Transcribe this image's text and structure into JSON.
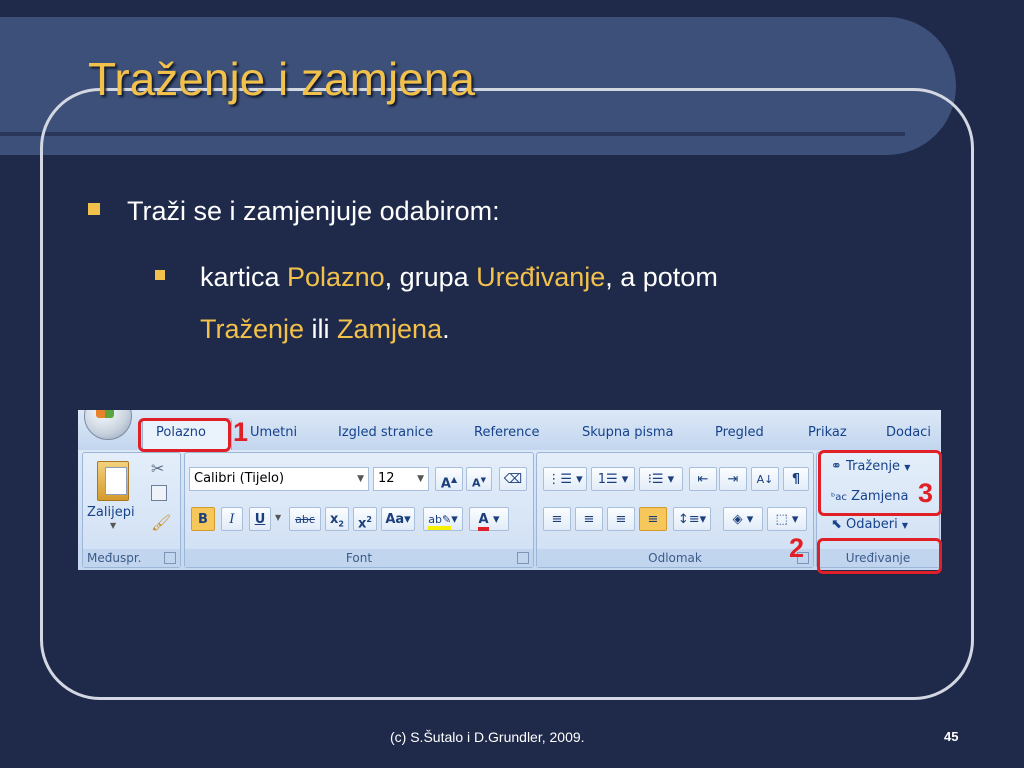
{
  "slide": {
    "title": "Traženje i zamjena",
    "bullet1": "Traži se i zamjenjuje odabirom:",
    "bullet2": {
      "prefix": "kartica ",
      "tab": "Polazno",
      "mid": ", grupa ",
      "group": "Uređivanje",
      "mid2": ", a potom",
      "find": "Traženje",
      "or": " ili ",
      "replace": "Zamjena",
      "end": "."
    },
    "footer": "(c) S.Šutalo i D.Grundler, 2009.",
    "page_number": "45"
  },
  "colors": {
    "accent": "#f2c14c",
    "background": "#1f2a4a",
    "marker": "#e01f26"
  },
  "ribbon": {
    "tabs": [
      "Polazno",
      "Umetni",
      "Izgled stranice",
      "Reference",
      "Skupna pisma",
      "Pregled",
      "Prikaz",
      "Dodaci"
    ],
    "active_tab": "Polazno",
    "clipboard": {
      "paste_label": "Zalijepi",
      "group_label": "Međuspr."
    },
    "font": {
      "font_name": "Calibri (Tijelo)",
      "font_size": "12",
      "group_label": "Font"
    },
    "paragraph": {
      "group_label": "Odlomak"
    },
    "editing": {
      "find": "Traženje",
      "replace": "Zamjena",
      "select": "Odaberi",
      "group_label": "Uređivanje"
    },
    "markers": [
      "1",
      "2",
      "3"
    ]
  }
}
